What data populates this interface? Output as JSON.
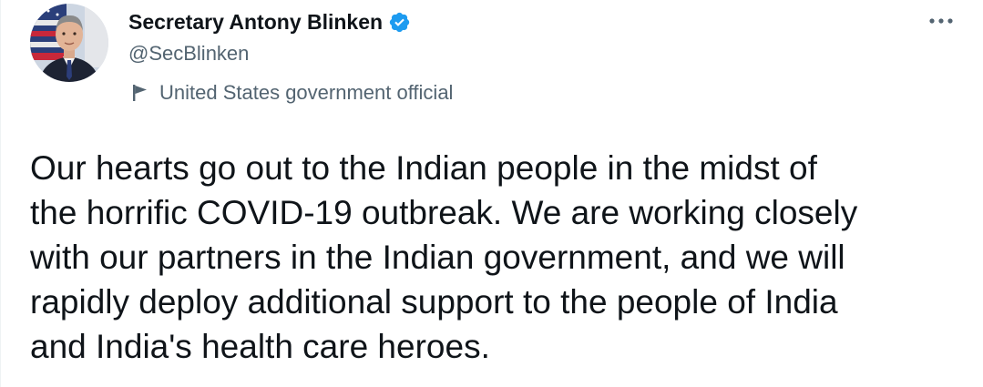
{
  "tweet": {
    "author": {
      "display_name": "Secretary Antony Blinken",
      "handle": "@SecBlinken",
      "verified": true,
      "label": "United States government official",
      "label_icon": "flag-icon",
      "avatar_icon": "avatar"
    },
    "more_icon": "more-icon",
    "text": "Our hearts go out to the Indian people in the midst of\nthe horrific COVID-19 outbreak. We are working closely\nwith our partners in the Indian government, and we will\nrapidly deploy additional support to the people of India\nand India's health care heroes."
  },
  "colors": {
    "text_primary": "#0f1419",
    "text_secondary": "#536471",
    "verified_blue": "#1d9bf0",
    "background": "#ffffff"
  }
}
